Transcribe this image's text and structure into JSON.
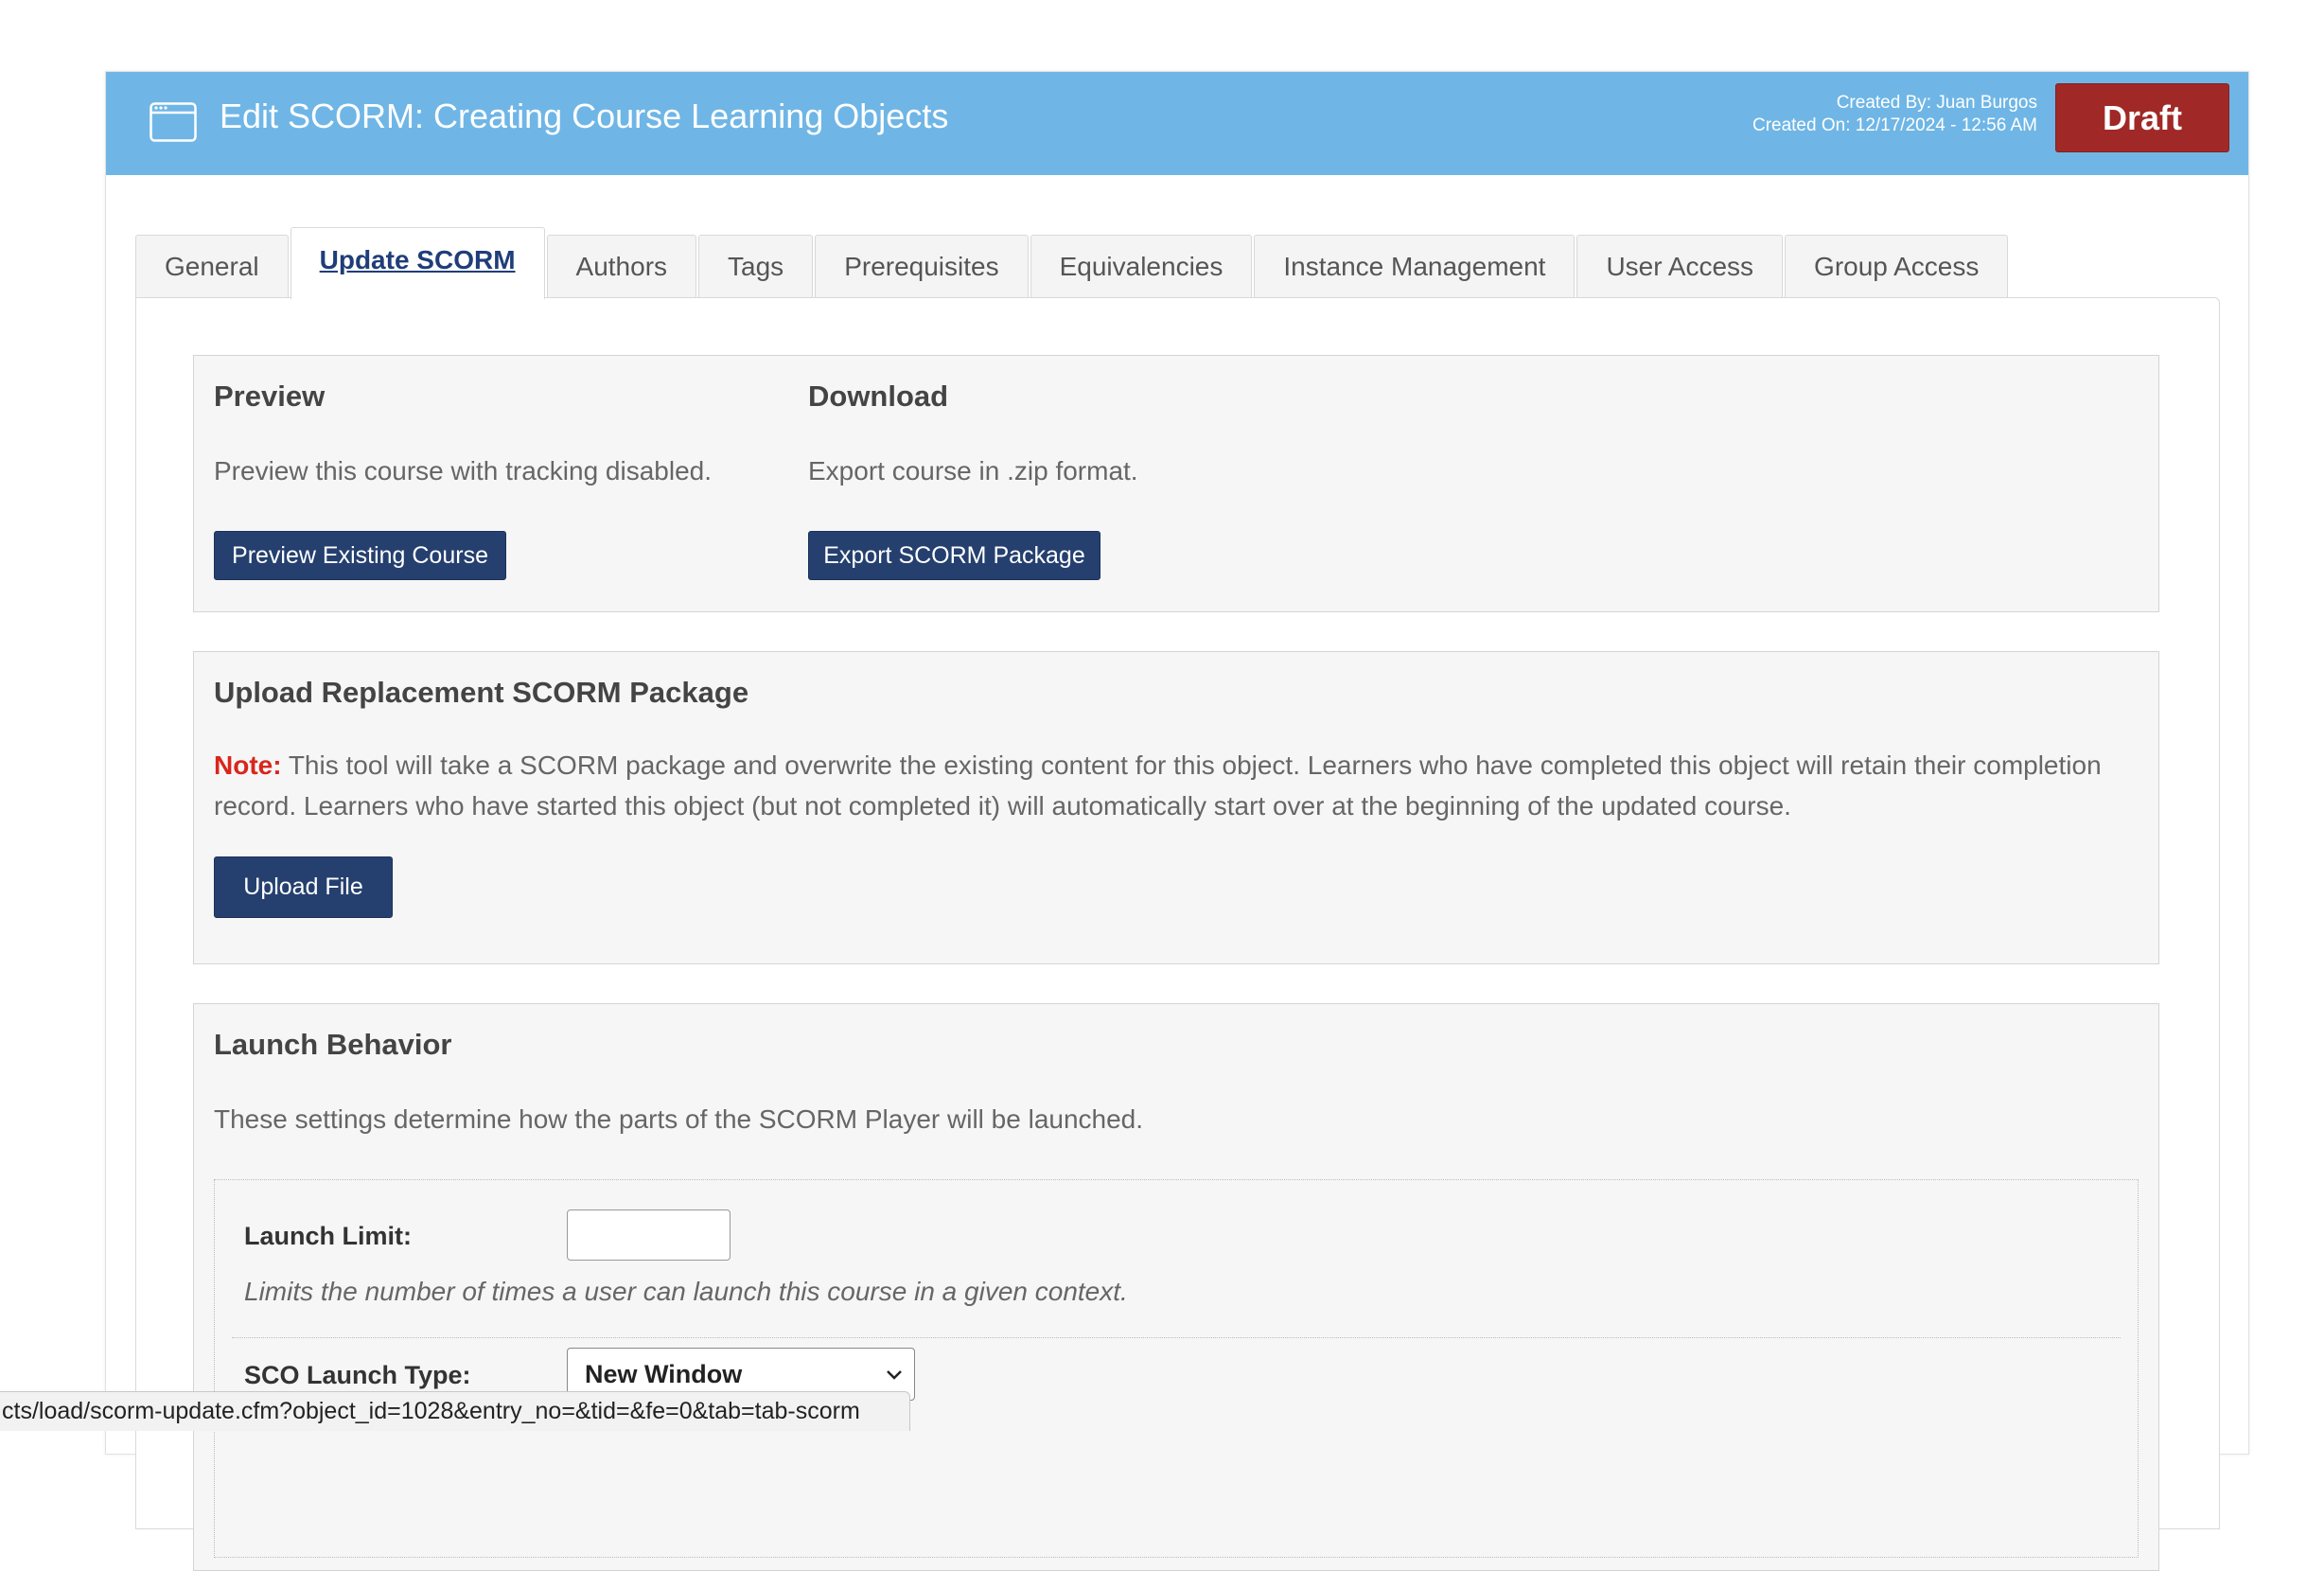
{
  "header": {
    "title": "Edit SCORM: Creating Course Learning Objects",
    "created_by": "Created By: Juan Burgos",
    "created_on": "Created On: 12/17/2024 - 12:56 AM",
    "status_button": "Draft",
    "colors": {
      "header_bg": "#6fb6e6",
      "draft_bg": "#a02927"
    }
  },
  "tabs": [
    {
      "label": "General"
    },
    {
      "label": "Update SCORM",
      "active": true
    },
    {
      "label": "Authors"
    },
    {
      "label": "Tags"
    },
    {
      "label": "Prerequisites"
    },
    {
      "label": "Equivalencies"
    },
    {
      "label": "Instance Management"
    },
    {
      "label": "User Access"
    },
    {
      "label": "Group Access"
    }
  ],
  "preview": {
    "title": "Preview",
    "description": "Preview this course with tracking disabled.",
    "button": "Preview Existing Course"
  },
  "download": {
    "title": "Download",
    "description": "Export course in .zip format.",
    "button": "Export SCORM Package"
  },
  "upload": {
    "title": "Upload Replacement SCORM Package",
    "note_label": "Note:",
    "note_text": " This tool will take a SCORM package and overwrite the existing content for this object. Learners who have completed this object will retain their completion record. Learners who have started this object (but not completed it) will automatically start over at the beginning of the updated course.",
    "button": "Upload File"
  },
  "launch": {
    "title": "Launch Behavior",
    "description": "These settings determine how the parts of the SCORM Player will be launched.",
    "limit_label": "Launch Limit:",
    "limit_value": "",
    "limit_hint": "Limits the number of times a user can launch this course in a given context.",
    "sco_label": "SCO Launch Type:",
    "sco_value": "New Window"
  },
  "statusbar": {
    "url": "cts/load/scorm-update.cfm?object_id=1028&entry_no=&tid=&fe=0&tab=tab-scorm"
  }
}
